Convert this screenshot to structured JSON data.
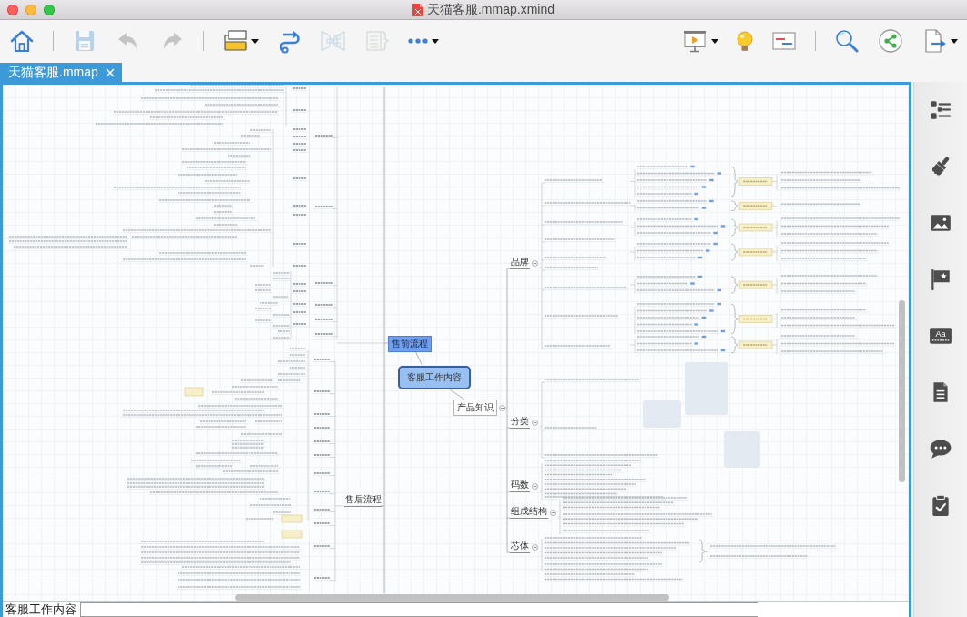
{
  "window": {
    "title": "天猫客服.mmap.xmind"
  },
  "toolbar": {
    "left": [
      {
        "kind": "home",
        "disabled": false
      },
      {
        "kind": "separator"
      },
      {
        "kind": "save",
        "disabled": true
      },
      {
        "kind": "undo",
        "disabled": true
      },
      {
        "kind": "redo",
        "disabled": true
      },
      {
        "kind": "separator"
      },
      {
        "kind": "topic",
        "disabled": false,
        "dropdown": true
      },
      {
        "kind": "relationship",
        "disabled": false
      },
      {
        "kind": "structure",
        "disabled": true
      },
      {
        "kind": "summary",
        "disabled": true
      },
      {
        "kind": "more",
        "disabled": false,
        "dropdown": true
      }
    ],
    "right": [
      {
        "kind": "presentation",
        "disabled": false,
        "dropdown": true
      },
      {
        "kind": "idea",
        "disabled": false
      },
      {
        "kind": "gantt",
        "disabled": false
      },
      {
        "kind": "separator"
      },
      {
        "kind": "search",
        "disabled": false
      },
      {
        "kind": "share",
        "disabled": false
      },
      {
        "kind": "export",
        "disabled": false,
        "dropdown": true
      }
    ]
  },
  "tabs": [
    {
      "label": "天猫客服.mmap",
      "selected": true
    }
  ],
  "mindmap": {
    "central_topic": {
      "label": "客服工作内容",
      "selected": false
    },
    "main_topics": [
      {
        "label": "售前流程",
        "kind": "boxed",
        "selected": true
      },
      {
        "label": "售后流程",
        "kind": "underline",
        "selected": false
      },
      {
        "label": "产品知识",
        "kind": "boxed",
        "selected": false,
        "children": [
          {
            "label": "品牌",
            "selected": false
          },
          {
            "label": "分类",
            "selected": false
          },
          {
            "label": "码数",
            "selected": false
          },
          {
            "label": "组成结构",
            "selected": false
          },
          {
            "label": "芯体",
            "selected": false
          }
        ]
      }
    ]
  },
  "bottom_bar": {
    "label": "客服工作内容"
  },
  "sidebar": {
    "items": [
      {
        "kind": "outline",
        "selected": false
      },
      {
        "kind": "format",
        "selected": false
      },
      {
        "kind": "image",
        "selected": false
      },
      {
        "kind": "marker",
        "selected": false
      },
      {
        "kind": "text",
        "glyph": "Aa",
        "selected": false
      },
      {
        "kind": "notes",
        "selected": false
      },
      {
        "kind": "comments",
        "selected": false
      },
      {
        "kind": "task",
        "selected": false
      }
    ]
  }
}
